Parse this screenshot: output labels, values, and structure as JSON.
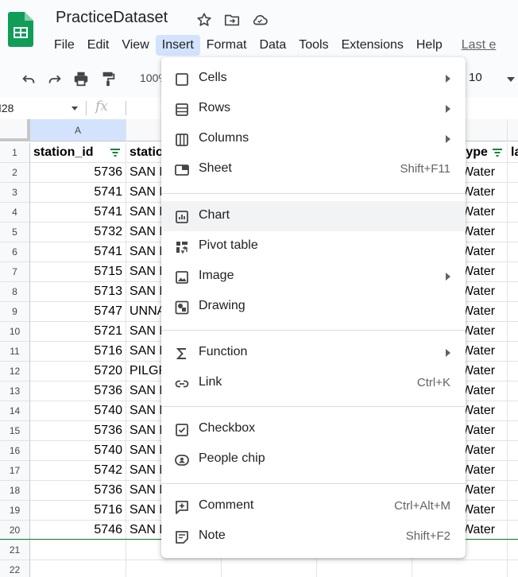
{
  "app": {
    "doc_title": "PracticeDataset",
    "menus": [
      "File",
      "Edit",
      "View",
      "Insert",
      "Format",
      "Data",
      "Tools",
      "Extensions",
      "Help"
    ],
    "last_edit_link": "Last e",
    "active_menu": "Insert"
  },
  "toolbar": {
    "zoom": "100%",
    "font_size": "10",
    "icons": [
      "undo-icon",
      "redo-icon",
      "print-icon",
      "paint-format-icon"
    ]
  },
  "formula_bar": {
    "name_box": "I28",
    "fx_label": "fx"
  },
  "grid": {
    "column_headers": [
      "A",
      "",
      "",
      "",
      "",
      ""
    ],
    "selected_column": "A",
    "header_row": {
      "row_num": "1",
      "station_id": "station_id",
      "station_name": "statio",
      "type": "type",
      "last": "la"
    },
    "rows": [
      {
        "n": "2",
        "id": "5736",
        "name": "SAN L",
        "type": "Water"
      },
      {
        "n": "3",
        "id": "5741",
        "name": "SAN L",
        "type": "Water"
      },
      {
        "n": "4",
        "id": "5741",
        "name": "SAN L",
        "type": "Water"
      },
      {
        "n": "5",
        "id": "5732",
        "name": "SAN L",
        "type": "Water"
      },
      {
        "n": "6",
        "id": "5741",
        "name": "SAN L",
        "type": "Water"
      },
      {
        "n": "7",
        "id": "5715",
        "name": "SAN L",
        "type": "Water"
      },
      {
        "n": "8",
        "id": "5713",
        "name": "SAN L",
        "type": "Water"
      },
      {
        "n": "9",
        "id": "5747",
        "name": "UNNA",
        "type": "Water"
      },
      {
        "n": "10",
        "id": "5721",
        "name": "SAN L",
        "type": "Water"
      },
      {
        "n": "11",
        "id": "5716",
        "name": "SAN L",
        "type": "Water"
      },
      {
        "n": "12",
        "id": "5720",
        "name": "PILGR",
        "type": "Water"
      },
      {
        "n": "13",
        "id": "5736",
        "name": "SAN L",
        "type": "Water"
      },
      {
        "n": "14",
        "id": "5740",
        "name": "SAN L",
        "type": "Water"
      },
      {
        "n": "15",
        "id": "5736",
        "name": "SAN L",
        "type": "Water"
      },
      {
        "n": "16",
        "id": "5740",
        "name": "SAN L",
        "type": "Water"
      },
      {
        "n": "17",
        "id": "5742",
        "name": "SAN L",
        "type": "Water"
      },
      {
        "n": "18",
        "id": "5736",
        "name": "SAN L",
        "type": "Water"
      },
      {
        "n": "19",
        "id": "5716",
        "name": "SAN L",
        "type": "Water"
      },
      {
        "n": "20",
        "id": "5746",
        "name": "SAN L",
        "type": "Water"
      },
      {
        "n": "21",
        "id": "",
        "name": "",
        "type": ""
      },
      {
        "n": "22",
        "id": "",
        "name": "",
        "type": ""
      }
    ]
  },
  "insert_menu": {
    "items": [
      {
        "label": "Cells",
        "icon": "cells-icon",
        "submenu": true,
        "shortcut": ""
      },
      {
        "label": "Rows",
        "icon": "rows-icon",
        "submenu": true,
        "shortcut": ""
      },
      {
        "label": "Columns",
        "icon": "columns-icon",
        "submenu": true,
        "shortcut": ""
      },
      {
        "label": "Sheet",
        "icon": "sheet-icon",
        "submenu": false,
        "shortcut": "Shift+F11"
      },
      {
        "label": "Chart",
        "icon": "chart-icon",
        "submenu": false,
        "shortcut": ""
      },
      {
        "label": "Pivot table",
        "icon": "pivot-table-icon",
        "submenu": false,
        "shortcut": ""
      },
      {
        "label": "Image",
        "icon": "image-icon",
        "submenu": true,
        "shortcut": ""
      },
      {
        "label": "Drawing",
        "icon": "drawing-icon",
        "submenu": false,
        "shortcut": ""
      },
      {
        "label": "Function",
        "icon": "function-icon",
        "submenu": true,
        "shortcut": ""
      },
      {
        "label": "Link",
        "icon": "link-icon",
        "submenu": false,
        "shortcut": "Ctrl+K"
      },
      {
        "label": "Checkbox",
        "icon": "checkbox-icon",
        "submenu": false,
        "shortcut": ""
      },
      {
        "label": "People chip",
        "icon": "people-chip-icon",
        "submenu": false,
        "shortcut": ""
      },
      {
        "label": "Comment",
        "icon": "comment-icon",
        "submenu": false,
        "shortcut": "Ctrl+Alt+M"
      },
      {
        "label": "Note",
        "icon": "note-icon",
        "submenu": false,
        "shortcut": "Shift+F2"
      }
    ],
    "hovered": "Chart"
  },
  "colors": {
    "accent": "#d3e3fd",
    "brand_green": "#0f9d58",
    "filter_green": "#188038",
    "menu_hover": "#f1f3f4"
  }
}
